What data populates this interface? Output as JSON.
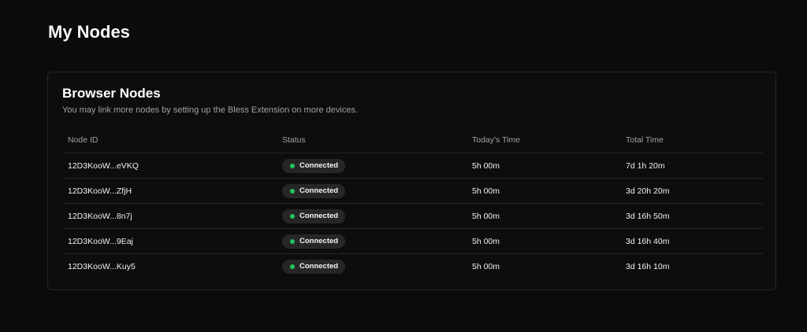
{
  "page": {
    "title": "My Nodes"
  },
  "card": {
    "title": "Browser Nodes",
    "subtitle": "You may link more nodes by setting up the Bless Extension on more devices."
  },
  "table": {
    "headers": {
      "node_id": "Node ID",
      "status": "Status",
      "todays_time": "Today's Time",
      "total_time": "Total Time"
    },
    "rows": [
      {
        "node_id": "12D3KooW...eVKQ",
        "status": "Connected",
        "todays_time": "5h 00m",
        "total_time": "7d 1h 20m"
      },
      {
        "node_id": "12D3KooW...ZfjH",
        "status": "Connected",
        "todays_time": "5h 00m",
        "total_time": "3d 20h 20m"
      },
      {
        "node_id": "12D3KooW...8n7j",
        "status": "Connected",
        "todays_time": "5h 00m",
        "total_time": "3d 16h 50m"
      },
      {
        "node_id": "12D3KooW...9Eaj",
        "status": "Connected",
        "todays_time": "5h 00m",
        "total_time": "3d 16h 40m"
      },
      {
        "node_id": "12D3KooW...Kuy5",
        "status": "Connected",
        "todays_time": "5h 00m",
        "total_time": "3d 16h 10m"
      }
    ]
  },
  "colors": {
    "background": "#0b0b0b",
    "status_connected": "#22c55e",
    "badge_background": "#262626"
  }
}
